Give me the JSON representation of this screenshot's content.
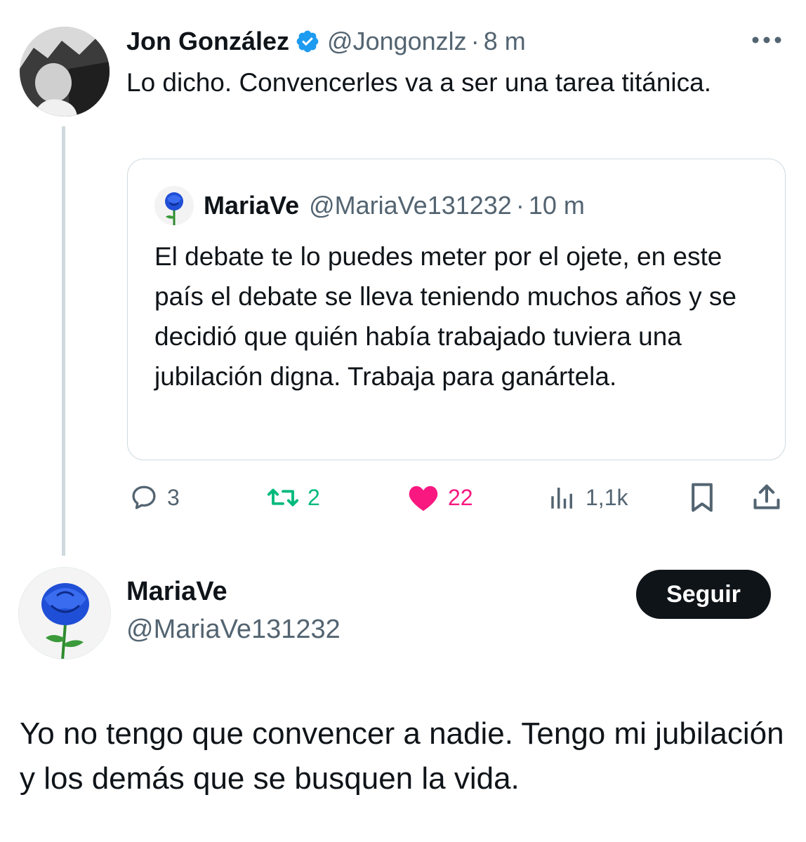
{
  "colors": {
    "verified": "#1d9bf0",
    "retweet": "#00ba7c",
    "like": "#f91880",
    "secondary_text": "#536471",
    "follow_button_bg": "#0f1419"
  },
  "top_tweet": {
    "author_name": "Jon González",
    "verified_icon": "verified-badge-icon",
    "handle": "@Jongonzlz",
    "separator": "·",
    "time": "8 m",
    "more_icon": "more-options-icon",
    "text": "Lo dicho. Convencerles va a ser una tarea titánica.",
    "quote": {
      "author_name": "MariaVe",
      "handle": "@MariaVe131232",
      "separator": "·",
      "time": "10 m",
      "text": "El debate te lo puedes meter por el ojete, en este país el debate se lleva teniendo muchos años y se decidió que quién había trabajado tuviera una jubilación digna. Trabaja para ganártela."
    },
    "actions": {
      "replies": "3",
      "retweets": "2",
      "likes": "22",
      "views": "1,1k",
      "icons": [
        "reply-icon",
        "retweet-icon",
        "like-icon",
        "views-icon",
        "bookmark-icon",
        "share-icon"
      ]
    }
  },
  "reply_tweet": {
    "author_name": "MariaVe",
    "handle": "@MariaVe131232",
    "follow_label": "Seguir",
    "text": "Yo no tengo que convencer a nadie. Tengo mi jubilación y los demás que se busquen la vida."
  }
}
